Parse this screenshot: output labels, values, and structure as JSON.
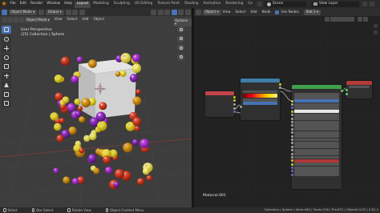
{
  "top_bar": {
    "menus": [
      "File",
      "Edit",
      "Render",
      "Window",
      "Help"
    ],
    "workspaces": [
      "Layout",
      "Modeling",
      "Sculpting",
      "UV Editing",
      "Texture Paint",
      "Shading",
      "Animation",
      "Rendering",
      "Co"
    ],
    "active_workspace": "Layout",
    "scene": "Scene",
    "view_layer": "View Layer"
  },
  "viewport": {
    "mode": "Object Mode",
    "menus": [
      "View",
      "Select",
      "Add",
      "Object"
    ],
    "transform_orientation": "Global",
    "options_label": "Options",
    "view_name": "User Perspective",
    "collection_info": "(25) Collection | Sphere"
  },
  "node_editor": {
    "editor_type": "Object",
    "menus": [
      "View",
      "Select",
      "Add",
      "Node"
    ],
    "use_nodes_label": "Use Nodes",
    "slot": "Slot 1",
    "material_name": "Material.001"
  },
  "status_bar": {
    "select": "Select",
    "box_select": "Box Select",
    "rotate_view": "Rotate View",
    "context_menu": "Object Context Menu",
    "stats": "Collection | Sphere | Verts:480 | Faces:518 | Tris:872 | Objects:1/25 | 2.81.1"
  },
  "colors": {
    "accent_blue": "#4772b3",
    "blender_orange": "#e87d0d",
    "node_texture_header": "#c2434a",
    "node_converter_header": "#3d7fa8",
    "node_shader_header": "#40a04b",
    "node_output_header": "#b43a3a"
  }
}
